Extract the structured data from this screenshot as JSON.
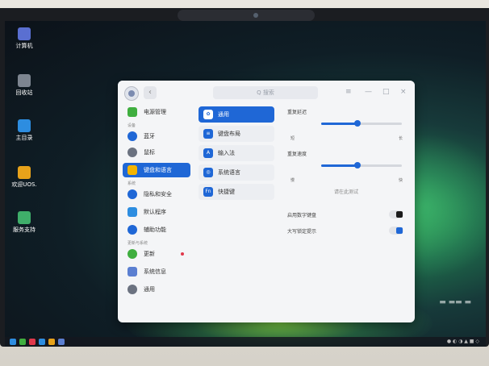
{
  "desktop": {
    "icons": [
      {
        "label": "计算机",
        "color": "#5a6fd1"
      },
      {
        "label": "回收站",
        "color": "#7d8590"
      },
      {
        "label": "主目录",
        "color": "#2d8de0"
      },
      {
        "label": "欢迎UOS.",
        "color": "#e7a21a"
      },
      {
        "label": "服务支持",
        "color": "#3fae6a"
      }
    ]
  },
  "window": {
    "search_placeholder": "Q 搜索",
    "controls": [
      "≡",
      "—",
      "□",
      "×"
    ],
    "sidebar": {
      "top_item": "电源管理",
      "group1": "设备",
      "items": [
        {
          "label": "蓝牙",
          "color": "#1f67d6"
        },
        {
          "label": "鼠标",
          "color": "#6b7280"
        },
        {
          "label": "键盘和语言",
          "color": "#f4b400",
          "active": true
        }
      ],
      "group2": "系统",
      "items2": [
        {
          "label": "隐私和安全",
          "color": "#1f67d6"
        },
        {
          "label": "默认程序",
          "color": "#2d8de0"
        },
        {
          "label": "辅助功能",
          "color": "#1f67d6"
        }
      ],
      "group3": "更新与系统",
      "items3": [
        {
          "label": "更新",
          "color": "#3fae3f"
        },
        {
          "label": "系统信息",
          "color": "#5b7fd1"
        },
        {
          "label": "通用",
          "color": "#6b7280"
        }
      ]
    },
    "middle": {
      "items": [
        {
          "label": "通用",
          "icon": "✿",
          "active": true
        },
        {
          "label": "键盘布局",
          "icon": "≡"
        },
        {
          "label": "输入法",
          "icon": "A"
        },
        {
          "label": "系统语言",
          "icon": "◎"
        },
        {
          "label": "快捷键",
          "icon": "Fn"
        }
      ]
    },
    "content": {
      "repeat_delay_label": "重复延迟",
      "repeat_delay_value": 0.45,
      "repeat_delay_min": "短",
      "repeat_delay_max": "长",
      "repeat_rate_label": "重复速度",
      "repeat_rate_value": 0.45,
      "repeat_rate_min": "慢",
      "repeat_rate_max": "快",
      "test_placeholder": "请在此测试",
      "numlock_label": "启用数字键盘",
      "numlock_on": true,
      "capslock_label": "大写锁定提示",
      "capslock_on": true
    }
  },
  "watermark": "▬ ▬▬ ▬"
}
